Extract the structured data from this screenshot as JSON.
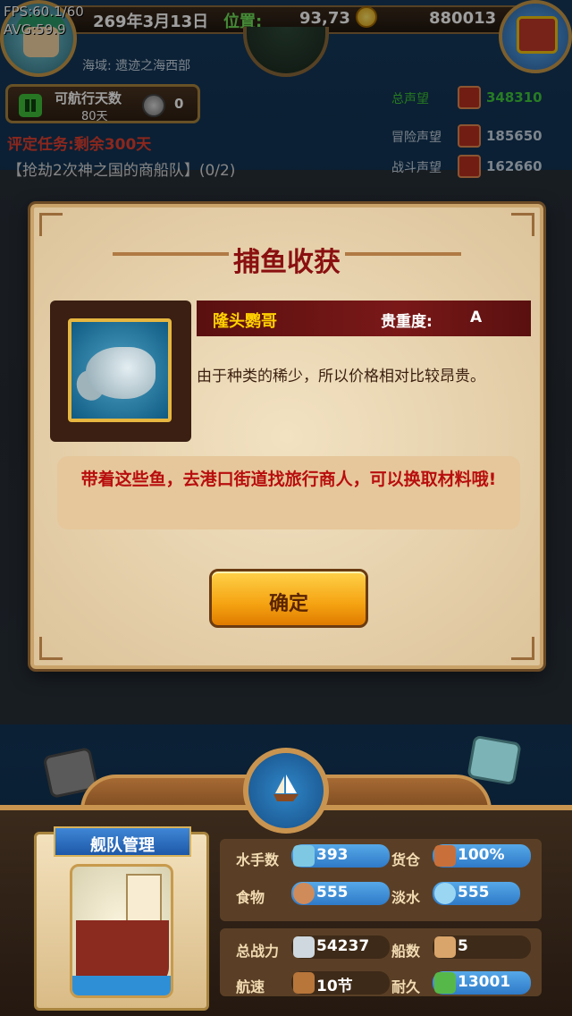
{
  "debug": {
    "fps": "FPS:60.1/60",
    "avg": "AVG:59.9"
  },
  "topbar": {
    "date": "269年3月13日",
    "position_label": "位置:",
    "position_value": "93,73",
    "gold": "880013"
  },
  "sea_area": "海域: 遗迹之海西部",
  "sail_days": {
    "label": "可航行天数",
    "value": "80天",
    "counter": "0"
  },
  "task": "评定任务:剩余300天",
  "quest": "【抢劫2次神之国的商船队】(0/2)",
  "reputation": [
    {
      "label": "总声望",
      "value": "348310",
      "color": "#3fc83a"
    },
    {
      "label": "冒险声望",
      "value": "185650",
      "color": "#c9d6e2"
    },
    {
      "label": "战斗声望",
      "value": "162660",
      "color": "#c9d6e2"
    }
  ],
  "dialog": {
    "title": "捕鱼收获",
    "fish_name": "隆头鹦哥",
    "rarity_label": "贵重度:",
    "rarity_value": "A",
    "description": "由于种类的稀少，所以价格相对比较昂贵。",
    "tip": "带着这些鱼，去港口街道找旅行商人，可以换取材料哦!",
    "confirm_label": "确定"
  },
  "fleet": {
    "title": "舰队管理",
    "stats": [
      {
        "label": "水手数",
        "value": "393",
        "icon": "sailor-icon"
      },
      {
        "label": "货仓",
        "value": "100%",
        "icon": "cargo-icon"
      },
      {
        "label": "食物",
        "value": "555",
        "icon": "meat-icon"
      },
      {
        "label": "淡水",
        "value": "555",
        "icon": "water-icon"
      },
      {
        "label": "总战力",
        "value": "54237",
        "icon": "power-icon"
      },
      {
        "label": "船数",
        "value": "5",
        "icon": "ship-count-icon"
      },
      {
        "label": "航速",
        "value": "10节",
        "icon": "speed-icon"
      },
      {
        "label": "耐久",
        "value": "13001",
        "icon": "durability-icon"
      }
    ]
  }
}
